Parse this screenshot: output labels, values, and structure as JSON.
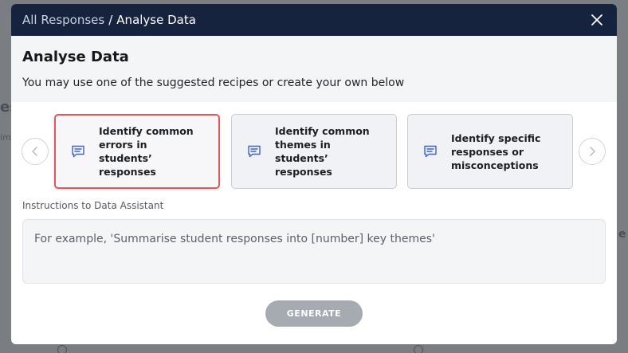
{
  "header": {
    "breadcrumb_parent": "All Responses",
    "breadcrumb_separator": "/",
    "breadcrumb_current": "Analyse Data"
  },
  "intro": {
    "title": "Analyse Data",
    "subtitle": "You may use one of the suggested recipes or create your own below"
  },
  "recipes": [
    {
      "label": "Identify common errors in students’ responses",
      "selected": true
    },
    {
      "label": "Identify common themes in students’ responses",
      "selected": false
    },
    {
      "label": "Identify specific responses or misconceptions",
      "selected": false
    }
  ],
  "instructions": {
    "label": "Instructions to Data Assistant",
    "placeholder": "For example, 'Summarise student responses into [number] key themes'",
    "value": ""
  },
  "actions": {
    "generate_label": "GENERATE"
  },
  "colors": {
    "header_bg": "#16233f",
    "selected_border": "#d95c5c",
    "icon_accent": "#3b63c9",
    "button_disabled": "#a6aab1"
  },
  "background_hint": {
    "left_text": "es",
    "left_small": "im",
    "right_text": "e"
  }
}
